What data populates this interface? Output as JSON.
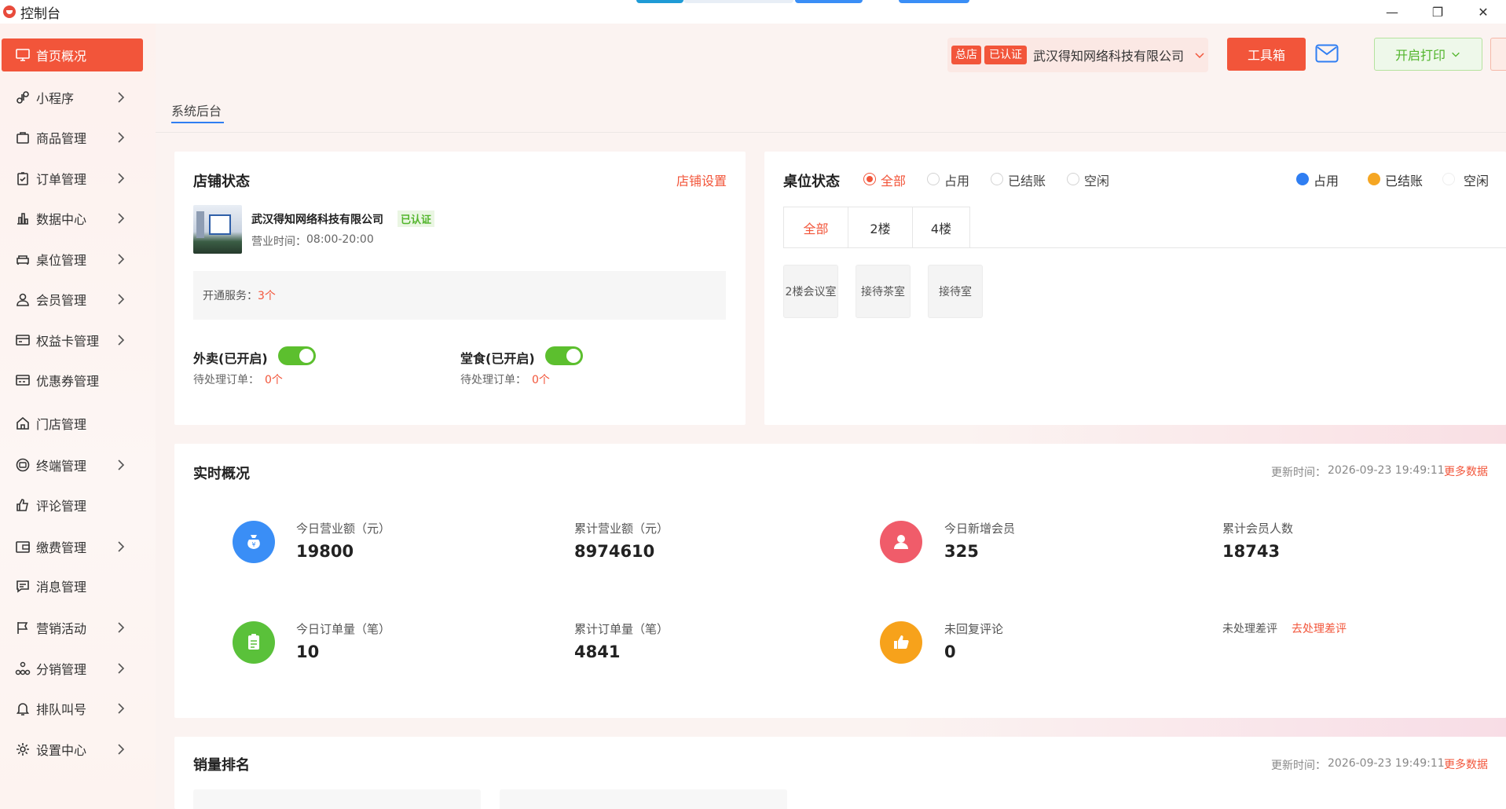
{
  "window": {
    "title": "控制台",
    "controls": {
      "minimize": "—",
      "maximize": "❐",
      "close": "✕"
    }
  },
  "sidebar": {
    "items": [
      {
        "label": "首页概况",
        "icon": "monitor-icon",
        "active": true,
        "has_submenu": false
      },
      {
        "label": "小程序",
        "icon": "miniprogram-icon",
        "has_submenu": true
      },
      {
        "label": "商品管理",
        "icon": "bag-icon",
        "has_submenu": true
      },
      {
        "label": "订单管理",
        "icon": "clipboard-icon",
        "has_submenu": true
      },
      {
        "label": "数据中心",
        "icon": "bar-chart-icon",
        "has_submenu": true
      },
      {
        "label": "桌位管理",
        "icon": "sofa-icon",
        "has_submenu": true
      },
      {
        "label": "会员管理",
        "icon": "user-icon",
        "has_submenu": true
      },
      {
        "label": "权益卡管理",
        "icon": "card-icon",
        "has_submenu": true
      },
      {
        "label": "优惠券管理",
        "icon": "coupon-icon",
        "has_submenu": false
      },
      {
        "label": "门店管理",
        "icon": "home-icon",
        "has_submenu": false
      },
      {
        "label": "终端管理",
        "icon": "terminal-icon",
        "has_submenu": true
      },
      {
        "label": "评论管理",
        "icon": "thumbs-up-icon",
        "has_submenu": false
      },
      {
        "label": "缴费管理",
        "icon": "wallet-icon",
        "has_submenu": true
      },
      {
        "label": "消息管理",
        "icon": "message-icon",
        "has_submenu": false
      },
      {
        "label": "营销活动",
        "icon": "flag-icon",
        "has_submenu": true
      },
      {
        "label": "分销管理",
        "icon": "network-icon",
        "has_submenu": true
      },
      {
        "label": "排队叫号",
        "icon": "bell-icon",
        "has_submenu": true
      },
      {
        "label": "设置中心",
        "icon": "gear-icon",
        "has_submenu": true
      }
    ]
  },
  "header": {
    "store_badge_main": "总店",
    "store_badge_cert": "已认证",
    "store_name": "武汉得知网络科技有限公司",
    "toolbox_label": "工具箱",
    "print_label": "开启打印"
  },
  "breadcrumb": {
    "tab": "系统后台"
  },
  "store_status": {
    "title": "店铺状态",
    "settings_link": "店铺设置",
    "company": "武汉得知网络科技有限公司",
    "cert_badge": "已认证",
    "hours_label": "营业时间：",
    "hours_value": "08:00-20:00",
    "services_label": "开通服务：",
    "services_value": "3个",
    "takeout": {
      "label": "外卖(已开启)",
      "pending_label": "待处理订单：",
      "pending_value": "0个",
      "enabled": true
    },
    "dinein": {
      "label": "堂食(已开启)",
      "pending_label": "待处理订单：",
      "pending_value": "0个",
      "enabled": true
    }
  },
  "table_status": {
    "title": "桌位状态",
    "filters": [
      {
        "label": "全部",
        "checked": true
      },
      {
        "label": "占用",
        "checked": false
      },
      {
        "label": "已结账",
        "checked": false
      },
      {
        "label": "空闲",
        "checked": false
      }
    ],
    "legend": [
      {
        "label": "占用",
        "color": "#2f7ef2"
      },
      {
        "label": "已结账",
        "color": "#f5a623"
      },
      {
        "label": "空闲",
        "color": "#ffffff"
      }
    ],
    "tabs": [
      {
        "label": "全部",
        "active": true
      },
      {
        "label": "2楼",
        "active": false
      },
      {
        "label": "4楼",
        "active": false
      }
    ],
    "rooms": [
      "2楼会议室",
      "接待茶室",
      "接待室"
    ]
  },
  "realtime": {
    "title": "实时概况",
    "updated_label": "更新时间：",
    "updated_value": "2026-09-23 19:49:11",
    "more_link": "更多数据",
    "stats": [
      {
        "label": "今日营业额（元）",
        "value": "19800",
        "icon": "money-bag-icon",
        "color": "#3a8ef6"
      },
      {
        "label": "累计营业额（元）",
        "value": "8974610"
      },
      {
        "label": "今日新增会员",
        "value": "325",
        "icon": "member-icon",
        "color": "#f05c6a"
      },
      {
        "label": "累计会员人数",
        "value": "18743"
      },
      {
        "label": "今日订单量（笔）",
        "value": "10",
        "icon": "order-icon",
        "color": "#5ac13a"
      },
      {
        "label": "累计订单量（笔）",
        "value": "4841"
      },
      {
        "label": "未回复评论",
        "value": "0",
        "icon": "like-icon",
        "color": "#f7a21b"
      },
      {
        "label": "未处理差评",
        "link": "去处理差评"
      }
    ]
  },
  "sales_rank": {
    "title": "销量排名",
    "updated_label": "更新时间：",
    "updated_value": "2026-09-23 19:49:11",
    "more_link": "更多数据"
  },
  "colors": {
    "accent": "#f2553a",
    "green": "#5cbf2e",
    "blue": "#2f7ef2"
  }
}
